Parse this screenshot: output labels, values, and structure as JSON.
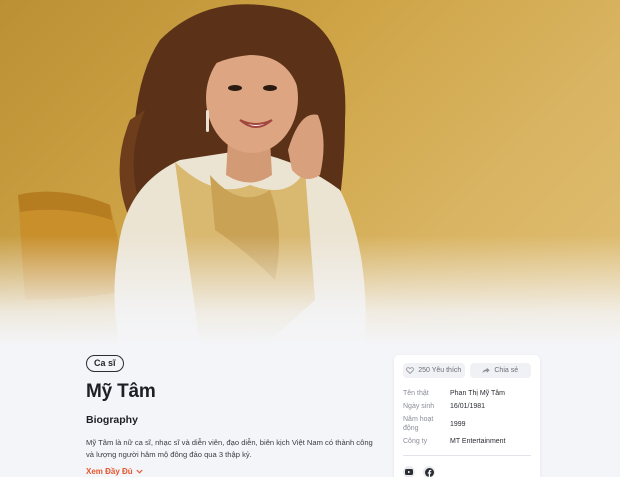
{
  "artist": {
    "category": "Ca sĩ",
    "name": "Mỹ Tâm",
    "section_title": "Biography",
    "bio": "Mỹ Tâm là nữ ca sĩ, nhạc sĩ và diễn viên, đạo diễn, biên kịch Việt Nam có thành công và lượng người hâm mộ đông đảo qua 3 thập kỷ.",
    "read_more": "Xem Đầy Đủ"
  },
  "actions": {
    "like_label": "250 Yêu thích",
    "share_label": "Chia sẻ"
  },
  "details": [
    {
      "label": "Tên thật",
      "value": "Phan Thị Mỹ Tâm"
    },
    {
      "label": "Ngày sinh",
      "value": "16/01/1981"
    },
    {
      "label": "Năm hoạt động",
      "value": "1999"
    },
    {
      "label": "Công ty",
      "value": "MT Entertainment"
    }
  ],
  "socials": [
    {
      "icon": "youtube-icon"
    },
    {
      "icon": "facebook-icon"
    }
  ],
  "colors": {
    "accent": "#e4572e",
    "hero_gold": "#cfa548",
    "background": "#f4f5f8"
  }
}
